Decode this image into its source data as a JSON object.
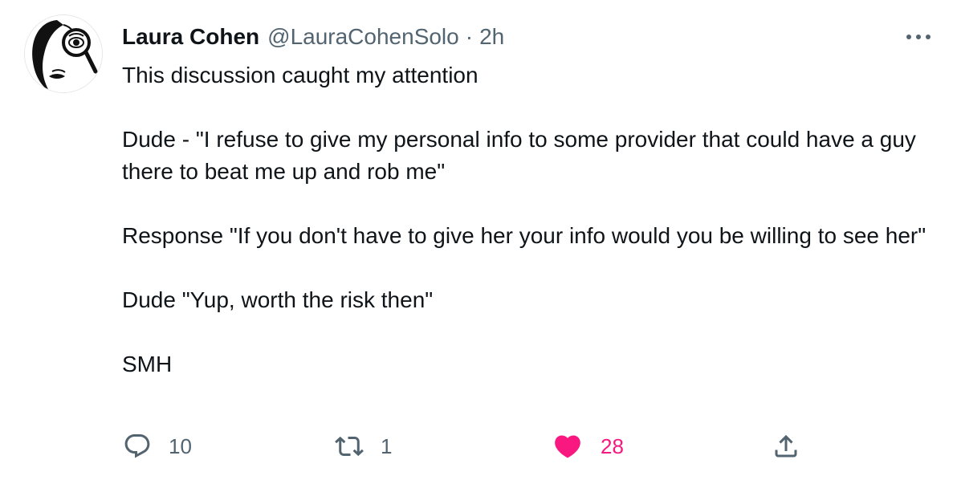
{
  "author": {
    "display_name": "Laura Cohen",
    "handle": "@LauraCohenSolo",
    "separator": "·",
    "timestamp": "2h"
  },
  "tweet": {
    "lines": [
      "This discussion caught my attention",
      "",
      "Dude - \"I refuse to give my personal info to some provider that could have a guy there to beat me up and rob me\"",
      "",
      "Response \"If you don't have to give her your info would you be willing to see her\"",
      "",
      "Dude \"Yup, worth the risk then\"",
      "",
      "SMH"
    ]
  },
  "actions": {
    "reply": {
      "icon": "reply-icon",
      "count": "10"
    },
    "retweet": {
      "icon": "retweet-icon",
      "count": "1"
    },
    "like": {
      "icon": "heart-icon",
      "count": "28",
      "active": true
    },
    "share": {
      "icon": "share-icon"
    }
  },
  "more_menu": {
    "icon": "more-icon"
  },
  "colors": {
    "text_primary": "#0f1419",
    "text_secondary": "#536471",
    "like_active": "#f91880"
  }
}
